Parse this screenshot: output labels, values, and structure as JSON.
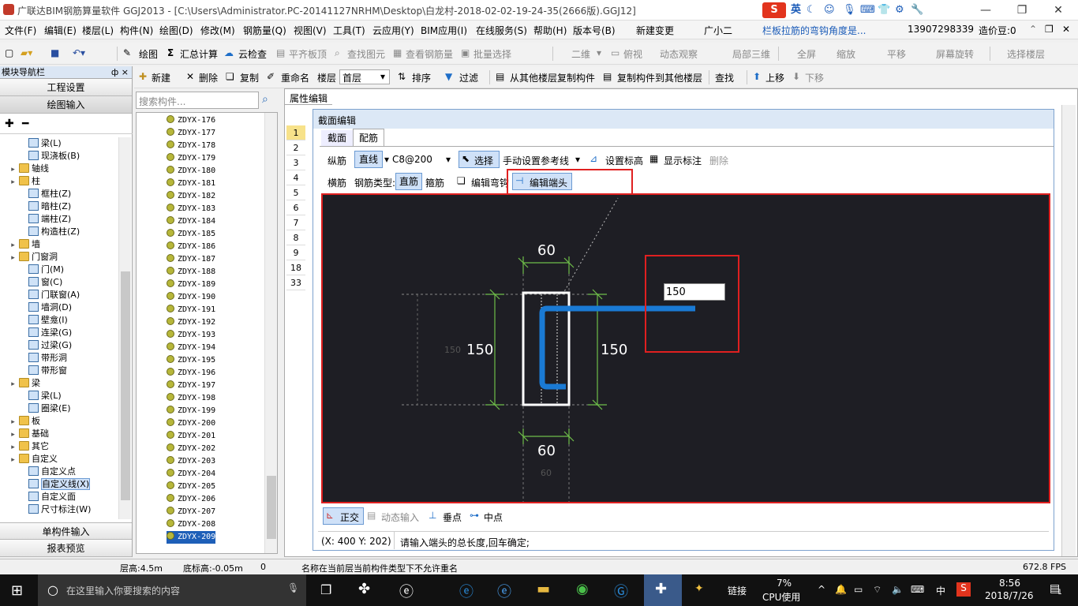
{
  "window": {
    "title": "广联达BIM钢筋算量软件 GGJ2013 - [C:\\Users\\Administrator.PC-20141127NRHM\\Desktop\\白龙村-2018-02-02-19-24-35(2666版).GGJ12]",
    "ime": [
      "英"
    ]
  },
  "menu": [
    "文件(F)",
    "编辑(E)",
    "楼层(L)",
    "构件(N)",
    "绘图(D)",
    "修改(M)",
    "钢筋量(Q)",
    "视图(V)",
    "工具(T)",
    "云应用(Y)",
    "BIM应用(I)",
    "在线服务(S)",
    "帮助(H)",
    "版本号(B)",
    "新建变更",
    "广小二"
  ],
  "menu_right": {
    "notice": "栏板拉筋的弯钩角度是...",
    "phone": "13907298339",
    "beans": "造价豆:0"
  },
  "toolbar1": {
    "draw": "绘图",
    "sum": "汇总计算",
    "cloud_check": "云检查",
    "align_top": "平齐板顶",
    "find_elem": "查找图元",
    "view_rebar": "查看钢筋量",
    "batch_select": "批量选择",
    "view_mode": "二维",
    "top_view": "俯视",
    "dynamic_view": "动态观察",
    "local_3d": "局部三维",
    "fullscreen": "全屏",
    "zoom": "缩放",
    "pan": "平移",
    "rotate": "屏幕旋转",
    "select_floor": "选择楼层"
  },
  "toolbar2": {
    "new": "新建",
    "delete": "删除",
    "copy": "复制",
    "rename": "重命名",
    "floor_label": "楼层",
    "floor_value": "首层",
    "sort": "排序",
    "filter": "过滤",
    "copy_from": "从其他楼层复制构件",
    "copy_to": "复制构件到其他楼层",
    "find": "查找",
    "move_up": "上移",
    "move_down": "下移"
  },
  "nav": {
    "header": "模块导航栏",
    "pin": "ф ×",
    "btn_project": "工程设置",
    "btn_draw": "绘图输入",
    "btn_single": "单构件输入",
    "btn_report": "报表预览",
    "tree": [
      {
        "label": "梁(L)",
        "type": "elem",
        "level": 2
      },
      {
        "label": "现浇板(B)",
        "type": "elem",
        "level": 2
      },
      {
        "label": "轴线",
        "type": "folder",
        "level": 1
      },
      {
        "label": "柱",
        "type": "folder",
        "level": 1
      },
      {
        "label": "框柱(Z)",
        "type": "elem",
        "level": 2
      },
      {
        "label": "暗柱(Z)",
        "type": "elem",
        "level": 2
      },
      {
        "label": "端柱(Z)",
        "type": "elem",
        "level": 2
      },
      {
        "label": "构造柱(Z)",
        "type": "elem",
        "level": 2
      },
      {
        "label": "墙",
        "type": "folder",
        "level": 1
      },
      {
        "label": "门窗洞",
        "type": "folder",
        "level": 1
      },
      {
        "label": "门(M)",
        "type": "elem",
        "level": 2
      },
      {
        "label": "窗(C)",
        "type": "elem",
        "level": 2
      },
      {
        "label": "门联窗(A)",
        "type": "elem",
        "level": 2
      },
      {
        "label": "墙洞(D)",
        "type": "elem",
        "level": 2
      },
      {
        "label": "壁龛(I)",
        "type": "elem",
        "level": 2
      },
      {
        "label": "连梁(G)",
        "type": "elem",
        "level": 2
      },
      {
        "label": "过梁(G)",
        "type": "elem",
        "level": 2
      },
      {
        "label": "带形洞",
        "type": "elem",
        "level": 2
      },
      {
        "label": "带形窗",
        "type": "elem",
        "level": 2
      },
      {
        "label": "梁",
        "type": "folder",
        "level": 1
      },
      {
        "label": "梁(L)",
        "type": "elem",
        "level": 2
      },
      {
        "label": "圈梁(E)",
        "type": "elem",
        "level": 2
      },
      {
        "label": "板",
        "type": "folder",
        "level": 1
      },
      {
        "label": "基础",
        "type": "folder",
        "level": 1
      },
      {
        "label": "其它",
        "type": "folder",
        "level": 1
      },
      {
        "label": "自定义",
        "type": "folder",
        "level": 1
      },
      {
        "label": "自定义点",
        "type": "elem",
        "level": 2
      },
      {
        "label": "自定义线(X)",
        "type": "elem",
        "level": 2
      },
      {
        "label": "自定义面",
        "type": "elem",
        "level": 2
      },
      {
        "label": "尺寸标注(W)",
        "type": "elem",
        "level": 2
      }
    ]
  },
  "search": {
    "placeholder": "搜索构件..."
  },
  "components": [
    "ZDYX-176",
    "ZDYX-177",
    "ZDYX-178",
    "ZDYX-179",
    "ZDYX-180",
    "ZDYX-181",
    "ZDYX-182",
    "ZDYX-183",
    "ZDYX-184",
    "ZDYX-185",
    "ZDYX-186",
    "ZDYX-187",
    "ZDYX-188",
    "ZDYX-189",
    "ZDYX-190",
    "ZDYX-191",
    "ZDYX-192",
    "ZDYX-193",
    "ZDYX-194",
    "ZDYX-195",
    "ZDYX-196",
    "ZDYX-197",
    "ZDYX-198",
    "ZDYX-199",
    "ZDYX-200",
    "ZDYX-201",
    "ZDYX-202",
    "ZDYX-203",
    "ZDYX-204",
    "ZDYX-205",
    "ZDYX-206",
    "ZDYX-207",
    "ZDYX-208",
    "ZDYX-209"
  ],
  "props": {
    "tab": "属性编辑",
    "rows": [
      "1",
      "2",
      "3",
      "4",
      "5",
      "6",
      "7",
      "8",
      "9",
      "18",
      "33"
    ]
  },
  "dialog": {
    "title": "截面编辑",
    "tab_section": "截面",
    "tab_rebar": "配筋",
    "longitudinal": "纵筋",
    "line": "直线",
    "rebar_spec": "C8@200",
    "select": "选择",
    "manual_ref": "手动设置参考线",
    "set_elev": "设置标高",
    "show_dim": "显示标注",
    "delete": "删除",
    "transverse": "横筋",
    "rebar_type": "钢筋类型:",
    "straight": "直筋",
    "stirrup": "箍筋",
    "edit_hook": "编辑弯钩",
    "edit_end": "编辑端头",
    "dim_top": "60",
    "dim_left": "150",
    "dim_left_gray": "150",
    "dim_right": "150",
    "dim_bottom": "60",
    "dim_bottom_gray": "60",
    "input_value": "150",
    "ortho": "正交",
    "dynamic_input": "动态输入",
    "perp_point": "垂点",
    "mid_point": "中点",
    "coords": "(X: 400 Y: 202)",
    "prompt": "请输入端头的总长度,回车确定;"
  },
  "status": {
    "floor_height": "层高:4.5m",
    "bottom_elev": "底标高:-0.05m",
    "zero": "0",
    "message": "名称在当前层当前构件类型下不允许重名",
    "fps": "672.8 FPS"
  },
  "taskbar": {
    "search_placeholder": "在这里输入你要搜索的内容",
    "link": "链接",
    "cpu_pct": "7%",
    "cpu_label": "CPU使用",
    "lang": "中",
    "time": "8:56",
    "date": "2018/7/26",
    "notif": "1"
  },
  "colors": {
    "canvas_bg": "#1e1e24",
    "rebar": "#1a7ad4",
    "highlight": "#e02020",
    "dim_line": "#6fbf4a"
  }
}
